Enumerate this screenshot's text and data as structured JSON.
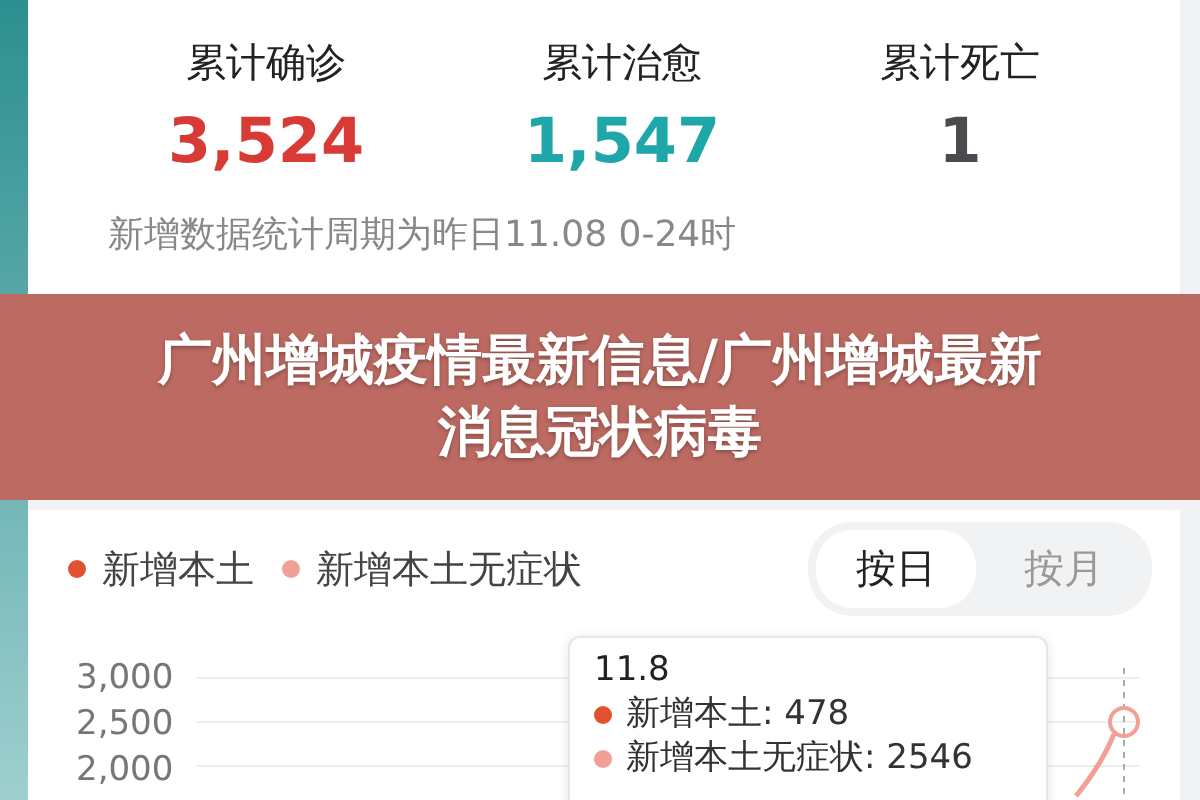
{
  "stats": [
    {
      "label": "累计确诊",
      "value": "3,524",
      "color": "#d83b36"
    },
    {
      "label": "累计治愈",
      "value": "1,547",
      "color": "#1fa6a8"
    },
    {
      "label": "累计死亡",
      "value": "1",
      "color": "#4a4a4f"
    }
  ],
  "period_note": "新增数据统计周期为昨日11.08 0-24时",
  "banner": {
    "title": "广州增城疫情最新信息/广州增城最新消息冠状病毒"
  },
  "legend": [
    {
      "label": "新增本土",
      "color": "#e0522f"
    },
    {
      "label": "新增本土无症状",
      "color": "#f2a097"
    }
  ],
  "toggle": [
    {
      "label": "按日",
      "selected": true
    },
    {
      "label": "按月",
      "selected": false
    }
  ],
  "y_axis_labels": [
    "3,000",
    "2,500",
    "2,000"
  ],
  "tooltip": {
    "date": "11.8",
    "items": [
      {
        "text": "新增本土: 478",
        "color": "#e0522f"
      },
      {
        "text": "新增本土无症状: 2546",
        "color": "#f2a097"
      }
    ]
  }
}
